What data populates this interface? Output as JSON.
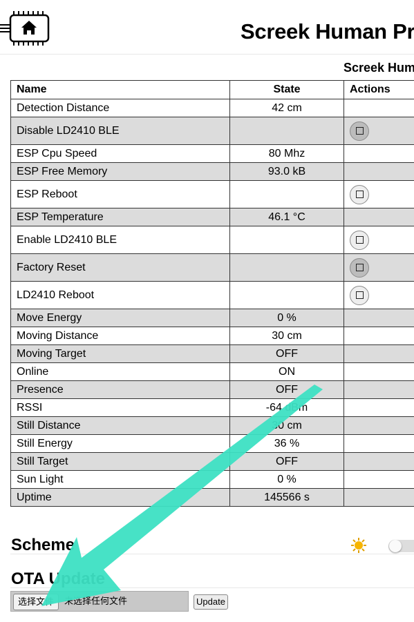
{
  "header": {
    "title": "Screek Human Pr",
    "subtitle": "Screek Hum"
  },
  "table": {
    "columns": [
      "Name",
      "State",
      "Actions"
    ],
    "rows": [
      {
        "name": "Detection Distance",
        "state": "42 cm",
        "action": false
      },
      {
        "name": "Disable LD2410 BLE",
        "state": "",
        "action": true
      },
      {
        "name": "ESP Cpu Speed",
        "state": "80 Mhz",
        "action": false
      },
      {
        "name": "ESP Free Memory",
        "state": "93.0 kB",
        "action": false
      },
      {
        "name": "ESP Reboot",
        "state": "",
        "action": true
      },
      {
        "name": "ESP Temperature",
        "state": "46.1 °C",
        "action": false
      },
      {
        "name": "Enable LD2410 BLE",
        "state": "",
        "action": true
      },
      {
        "name": "Factory Reset",
        "state": "",
        "action": true
      },
      {
        "name": "LD2410 Reboot",
        "state": "",
        "action": true
      },
      {
        "name": "Move Energy",
        "state": "0 %",
        "action": false
      },
      {
        "name": "Moving Distance",
        "state": "30 cm",
        "action": false
      },
      {
        "name": "Moving Target",
        "state": "OFF",
        "action": false
      },
      {
        "name": "Online",
        "state": "ON",
        "action": false
      },
      {
        "name": "Presence",
        "state": "OFF",
        "action": false
      },
      {
        "name": "RSSI",
        "state": "-64 dBm",
        "action": false
      },
      {
        "name": "Still Distance",
        "state": "30 cm",
        "action": false
      },
      {
        "name": "Still Energy",
        "state": "36 %",
        "action": false
      },
      {
        "name": "Still Target",
        "state": "OFF",
        "action": false
      },
      {
        "name": "Sun Light",
        "state": "0 %",
        "action": false
      },
      {
        "name": "Uptime",
        "state": "145566 s",
        "action": false
      }
    ]
  },
  "scheme": {
    "title": "Scheme",
    "icon": "sun-icon"
  },
  "ota": {
    "title": "OTA Update",
    "choose_file_label": "选择文件",
    "no_file_text": "未选择任何文件",
    "update_label": "Update"
  },
  "colors": {
    "row_alt": "#dcdcdc",
    "arrow": "#3de0c3"
  }
}
